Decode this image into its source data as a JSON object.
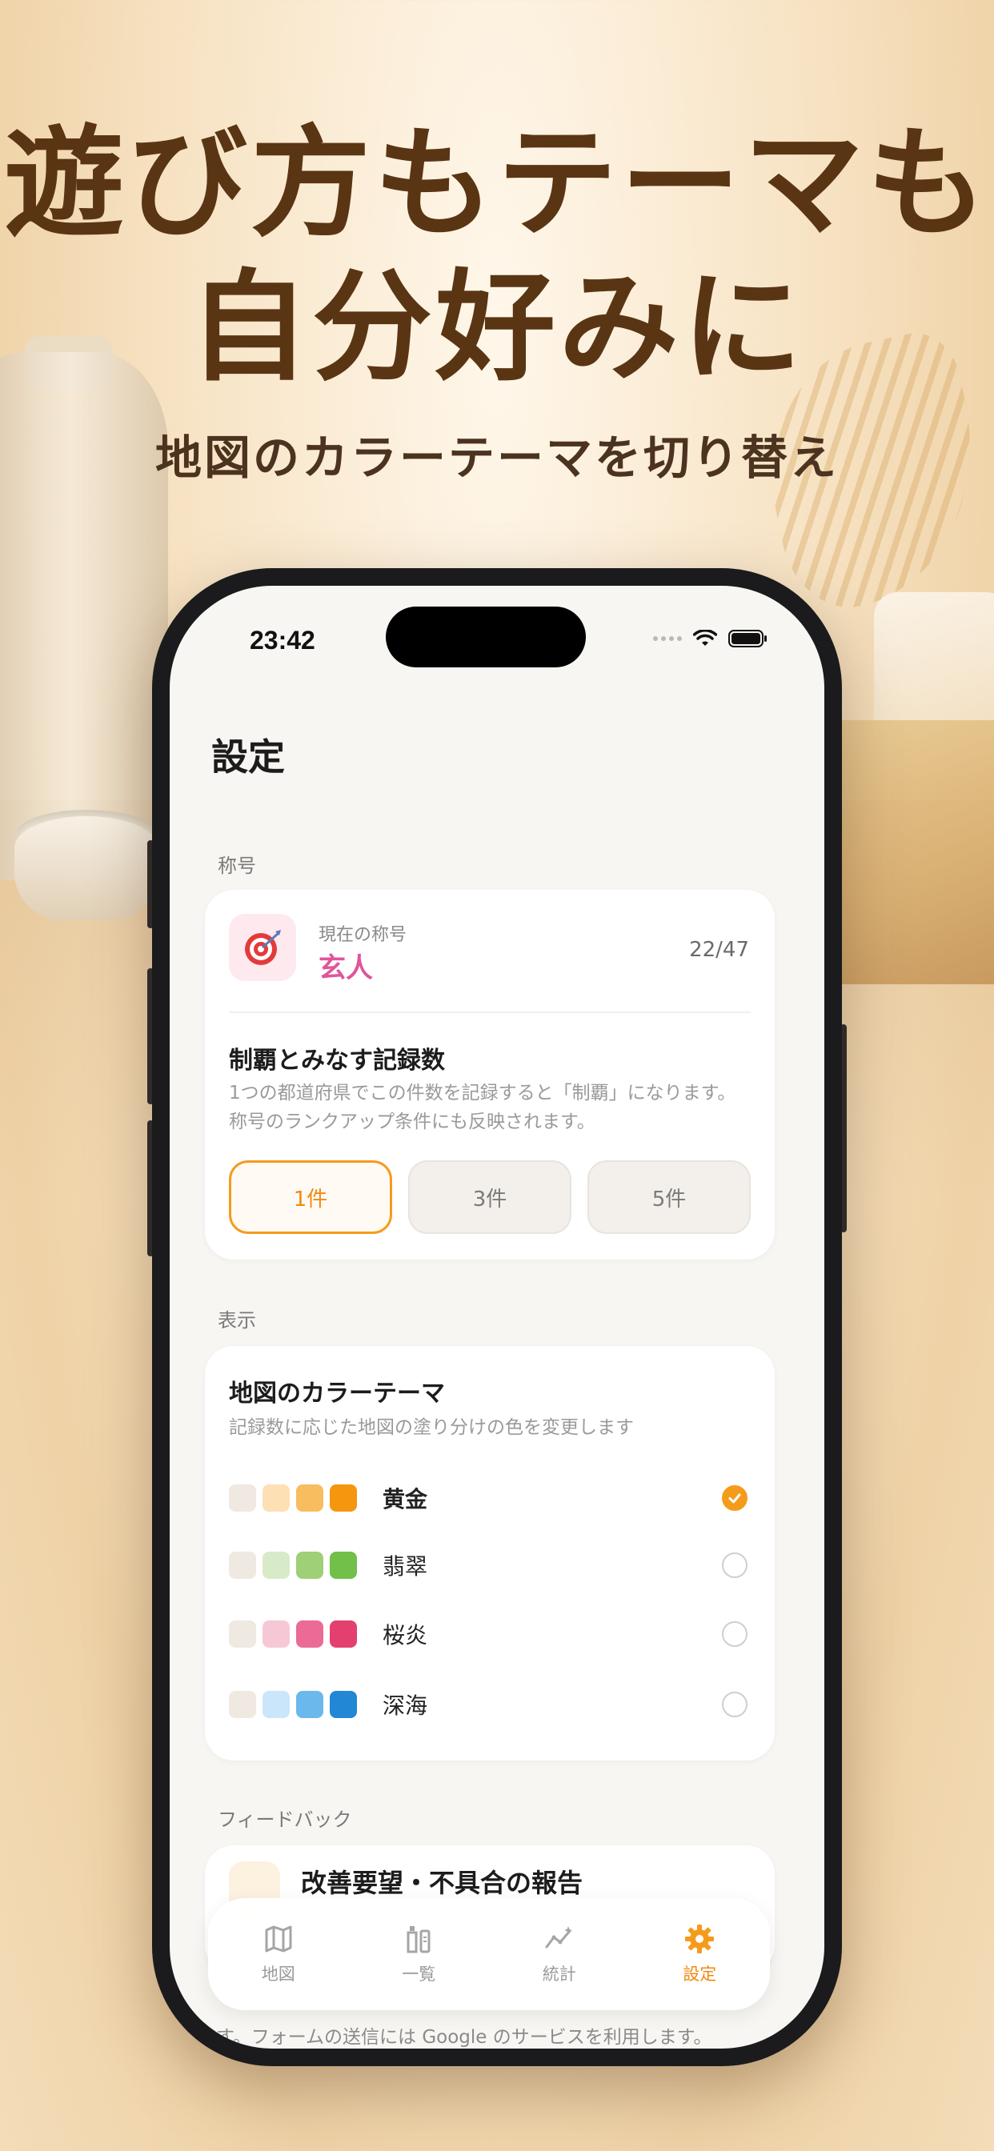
{
  "headline": {
    "line1": "遊び方もテーマも",
    "line2": "自分好みに",
    "subtitle": "地図のカラーテーマを切り替え"
  },
  "status_bar": {
    "time": "23:42"
  },
  "page_title": "設定",
  "sections": {
    "title_section": "称号",
    "display_section": "表示",
    "feedback_section": "フィードバック"
  },
  "title_card": {
    "current_label": "現在の称号",
    "current_name": "玄人",
    "count": "22/47",
    "record_title": "制覇とみなす記録数",
    "record_desc": "1つの都道府県でこの件数を記録すると「制覇」になります。称号のランクアップ条件にも反映されます。",
    "options": [
      "1件",
      "3件",
      "5件"
    ],
    "selected_option": "1件"
  },
  "theme_card": {
    "title": "地図のカラーテーマ",
    "desc": "記録数に応じた地図の塗り分けの色を変更します",
    "themes": [
      {
        "name": "黄金",
        "selected": true,
        "colors": [
          "#efe9e2",
          "#fde0b3",
          "#f8bd5f",
          "#f5960f"
        ]
      },
      {
        "name": "翡翠",
        "selected": false,
        "colors": [
          "#efe9e2",
          "#d8ebc9",
          "#9fcf76",
          "#72bf4a"
        ]
      },
      {
        "name": "桜炎",
        "selected": false,
        "colors": [
          "#efe9e2",
          "#f6c8d6",
          "#ec6a96",
          "#e3406f"
        ]
      },
      {
        "name": "深海",
        "selected": false,
        "colors": [
          "#efe9e2",
          "#c9e6fb",
          "#6ab8ec",
          "#2287d4"
        ]
      }
    ]
  },
  "feedback_card": {
    "title": "改善要望・不具合の報告"
  },
  "footer_text": "す。フォームの送信には Google のサービスを利用します。",
  "tabbar": {
    "tabs": [
      {
        "label": "地図",
        "icon": "map-icon",
        "active": false
      },
      {
        "label": "一覧",
        "icon": "bottle-list-icon",
        "active": false
      },
      {
        "label": "統計",
        "icon": "stats-icon",
        "active": false
      },
      {
        "label": "設定",
        "icon": "gear-icon",
        "active": true
      }
    ]
  },
  "colors": {
    "accent": "#f59b1c",
    "headline": "#5a3514",
    "title_name": "#e0559a"
  }
}
